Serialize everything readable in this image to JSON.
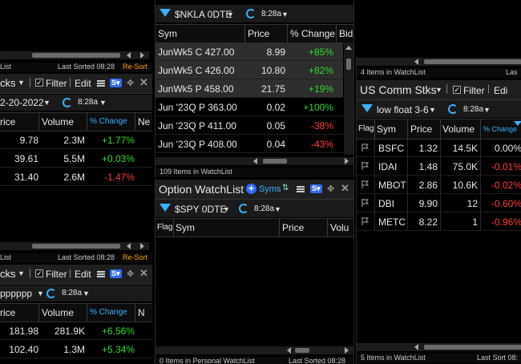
{
  "left_top": {
    "status_left": "List",
    "status_sorted": "Last Sorted 08:28",
    "status_resort": "Re-Sort",
    "title_fragment": "cks",
    "filter_label": "Filter",
    "edit_label": "Edit",
    "date_fragment": "2-20-2022",
    "time_label": "8:28a",
    "columns": [
      "rice",
      "Volume",
      "% Change",
      "Ne"
    ],
    "rows": [
      {
        "price": "9.78",
        "volume": "2.3M",
        "change": "+1.77%",
        "sign": "pos"
      },
      {
        "price": "39.61",
        "volume": "5.5M",
        "change": "+0.03%",
        "sign": "pos"
      },
      {
        "price": "31.40",
        "volume": "2.6M",
        "change": "-1.47%",
        "sign": "neg"
      }
    ]
  },
  "left_bottom": {
    "status_left": "List",
    "status_sorted": "Last Sorted 08:28",
    "status_resort": "Re-Sort",
    "title_fragment": "cks",
    "filter_label": "Filter",
    "edit_label": "Edit",
    "date_fragment": "pppppp",
    "time_label": "8:28a",
    "columns": [
      "rice",
      "Volume",
      "% Change",
      "N"
    ],
    "rows": [
      {
        "price": "181.98",
        "volume": "281.9K",
        "change": "+6.56%",
        "sign": "pos"
      },
      {
        "price": "102.40",
        "volume": "1.3M",
        "change": "+5.34%",
        "sign": "pos"
      }
    ]
  },
  "middle_top": {
    "filter_name": "$NKLA 0DTE",
    "time_label": "8:28a",
    "columns": [
      "Sym",
      "Price",
      "% Change",
      "Bid"
    ],
    "rows": [
      {
        "sym": "JunWk5 C 427.00",
        "price": "8.99",
        "change": "+85%",
        "sign": "pos"
      },
      {
        "sym": "JunWk5 C 426.00",
        "price": "10.80",
        "change": "+82%",
        "sign": "pos"
      },
      {
        "sym": "JunWk5 P 458.00",
        "price": "21.75",
        "change": "+19%",
        "sign": "pos"
      },
      {
        "sym": "Jun '23Q P 363.00",
        "price": "0.02",
        "change": "+100%",
        "sign": "pos"
      },
      {
        "sym": "Jun '23Q P 411.00",
        "price": "0.05",
        "change": "-38%",
        "sign": "neg"
      },
      {
        "sym": "Jun '23Q P 408.00",
        "price": "0.04",
        "change": "-43%",
        "sign": "neg"
      }
    ],
    "status": "109 Items in WatchList"
  },
  "middle_bottom": {
    "title": "Option WatchList",
    "syms_label": "Syms",
    "filter_name": "$SPY 0DTE",
    "time_label": "8:28a",
    "columns": [
      "Flag",
      "Sym",
      "Price",
      "Volu"
    ],
    "status_left": "0 Items in Personal WatchList",
    "status_right": "Last Sorted 08:28"
  },
  "right": {
    "status_top_left": "4 Items in WatchList",
    "status_top_right": "Las",
    "title": "US Comm Stks",
    "filter_label": "Filter",
    "edit_label": "Edi",
    "filter_name": "low float 3-6",
    "time_label": "8:28a",
    "columns": [
      "Flag",
      "Sym",
      "Price",
      "Volume",
      "% Change"
    ],
    "rows": [
      {
        "sym": "BSFC",
        "price": "1.32",
        "volume": "14.5K",
        "change": "0.00%",
        "sign": "flat"
      },
      {
        "sym": "IDAI",
        "price": "1.48",
        "volume": "75.0K",
        "change": "-0.01%",
        "sign": "neg"
      },
      {
        "sym": "MBOT",
        "price": "2.86",
        "volume": "10.6K",
        "change": "-0.02%",
        "sign": "neg"
      },
      {
        "sym": "DBI",
        "price": "9.90",
        "volume": "12",
        "change": "-0.60%",
        "sign": "neg"
      },
      {
        "sym": "METC",
        "price": "8.22",
        "volume": "1",
        "change": "-0.96%",
        "sign": "neg"
      }
    ],
    "status_left": "5 Items in WatchList",
    "status_right": "Last Sort 08:"
  }
}
